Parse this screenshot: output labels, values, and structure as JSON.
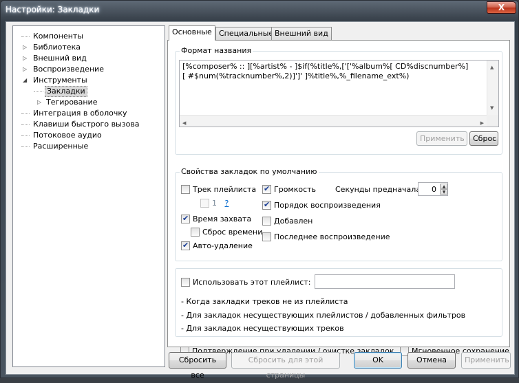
{
  "window": {
    "title": "Настройки: Закладки",
    "close_label": "X"
  },
  "tree": {
    "items": [
      {
        "label": "Компоненты",
        "arrow": ""
      },
      {
        "label": "Библиотека",
        "arrow": "▷"
      },
      {
        "label": "Внешний вид",
        "arrow": "▷"
      },
      {
        "label": "Воспроизведение",
        "arrow": "▷"
      },
      {
        "label": "Инструменты",
        "arrow": "◢"
      },
      {
        "label": "Закладки",
        "arrow": ""
      },
      {
        "label": "Тегирование",
        "arrow": "▷"
      },
      {
        "label": "Интеграция в оболочку",
        "arrow": ""
      },
      {
        "label": "Клавиши быстрого вызова",
        "arrow": ""
      },
      {
        "label": "Потоковое аудио",
        "arrow": ""
      },
      {
        "label": "Расширенные",
        "arrow": ""
      }
    ],
    "selected": "Закладки"
  },
  "tabs": [
    "Основные",
    "Специальные",
    "Внешний вид"
  ],
  "format": {
    "group_title": "Формат названия",
    "line1": "[%composer% :: ][%artist% - ]$if(%title%,['['%album%[ CD%discnumber%]",
    "line2": "[ #$num(%tracknumber%,2)]']' ]%title%,%_filename_ext%)",
    "apply_label": "Применить",
    "reset_label": "Сброс"
  },
  "defaults": {
    "group_title": "Свойства закладок по умолчанию",
    "playlist_track": "Трек плейлиста",
    "playlist_num": "1",
    "playlist_link": "?",
    "capture_time": "Время захвата",
    "reset_time": "Сброс времени",
    "auto_delete": "Авто-удаление",
    "volume": "Громкость",
    "playback_order": "Порядок воспроизведения",
    "added": "Добавлен",
    "last_played": "Последнее воспроизведение",
    "preroll_label": "Секунды предначала:",
    "preroll_value": "0"
  },
  "playlist": {
    "use_label": "Использовать этот плейлист:",
    "value": "",
    "note1": "- Когда закладки треков не из плейлиста",
    "note2": "- Для закладок несуществующих плейлистов / добавленных фильтров",
    "note3": "- Для закладок несуществующих треков"
  },
  "confirm_label": "Подтверждение при удалении / очистке закладок",
  "instant_save_label": "Мгновенное сохранение",
  "buttons": {
    "reset_all": "Сбросить все",
    "reset_page": "Сбросить для этой страницы",
    "ok": "OK",
    "cancel": "Отмена",
    "apply": "Применить"
  }
}
